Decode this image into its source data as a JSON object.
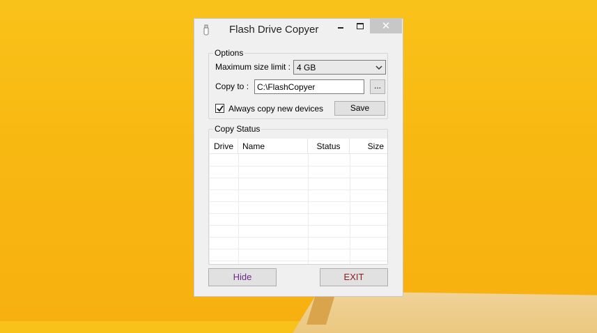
{
  "window": {
    "title": "Flash Drive Copyer"
  },
  "options": {
    "legend": "Options",
    "max_size_label": "Maximum size limit :",
    "max_size_value": "4 GB",
    "copy_to_label": "Copy to :",
    "copy_to_value": "C:\\FlashCopyer",
    "browse_label": "...",
    "always_copy_label": "Always copy new devices",
    "always_copy_checked": true,
    "save_label": "Save"
  },
  "status": {
    "legend": "Copy Status",
    "columns": [
      "Drive",
      "Name",
      "Status",
      "Size"
    ]
  },
  "footer": {
    "hide_label": "Hide",
    "exit_label": "EXIT"
  },
  "colors": {
    "desktop": "#f8b812",
    "hide_text": "#6b2a8a",
    "exit_text": "#8b1a1a"
  }
}
